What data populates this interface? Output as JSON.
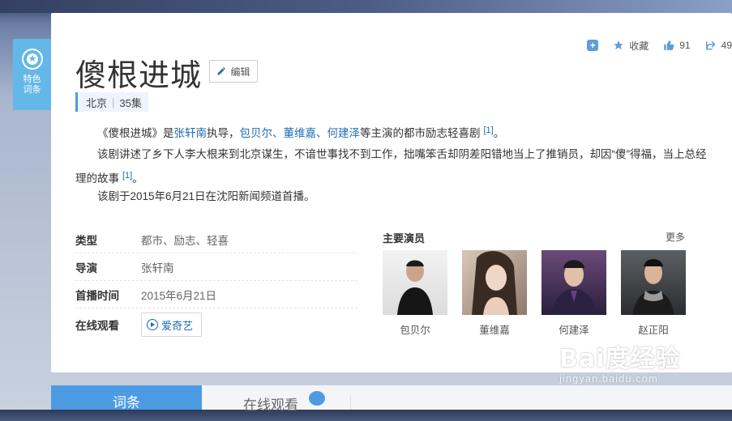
{
  "special_badge": {
    "label_line1": "特色",
    "label_line2": "词条"
  },
  "actions": {
    "collect_label": "收藏",
    "like_count": "91",
    "share_count": "49"
  },
  "title": "傻根进城",
  "edit_label": "编辑",
  "tags": [
    "北京",
    "35集"
  ],
  "summary": {
    "p1": {
      "prefix": "《傻根进城》是",
      "director": "张轩南",
      "mid1": "执导，",
      "actor1": "包贝尔",
      "sep1": "、",
      "actor2": "董维嘉",
      "sep2": "、",
      "actor3": "何建泽",
      "suffix": "等主演的都市励志轻喜剧",
      "ref": "[1]",
      "end": "。"
    },
    "p2": {
      "text": "该剧讲述了乡下人李大根来到北京谋生，不谙世事找不到工作，拙嘴笨舌却阴差阳错地当上了推销员，却因“傻”得福，当上总经理的故事",
      "ref": "[1]",
      "end": "。"
    },
    "p3": {
      "text": "该剧于2015年6月21日在沈阳新闻频道首播。"
    }
  },
  "info": {
    "type_key": "类型",
    "type_val": "都市、励志、轻喜",
    "director_key": "导演",
    "director_val": "张轩南",
    "premiere_key": "首播时间",
    "premiere_val": "2015年6月21日",
    "watch_key": "在线观看",
    "watch_val": "爱奇艺"
  },
  "cast": {
    "title": "主要演员",
    "more": "更多",
    "actors": [
      "包贝尔",
      "董维嘉",
      "何建泽",
      "赵正阳"
    ]
  },
  "tabs": {
    "active": "词条",
    "second": "在线观看"
  },
  "watermark": {
    "main": "Bai度经验",
    "sub": "jingyan.baidu.com"
  },
  "colors": {
    "accent": "#4d9be3",
    "link": "#1d6bb5",
    "badge": "#64b8e8"
  }
}
